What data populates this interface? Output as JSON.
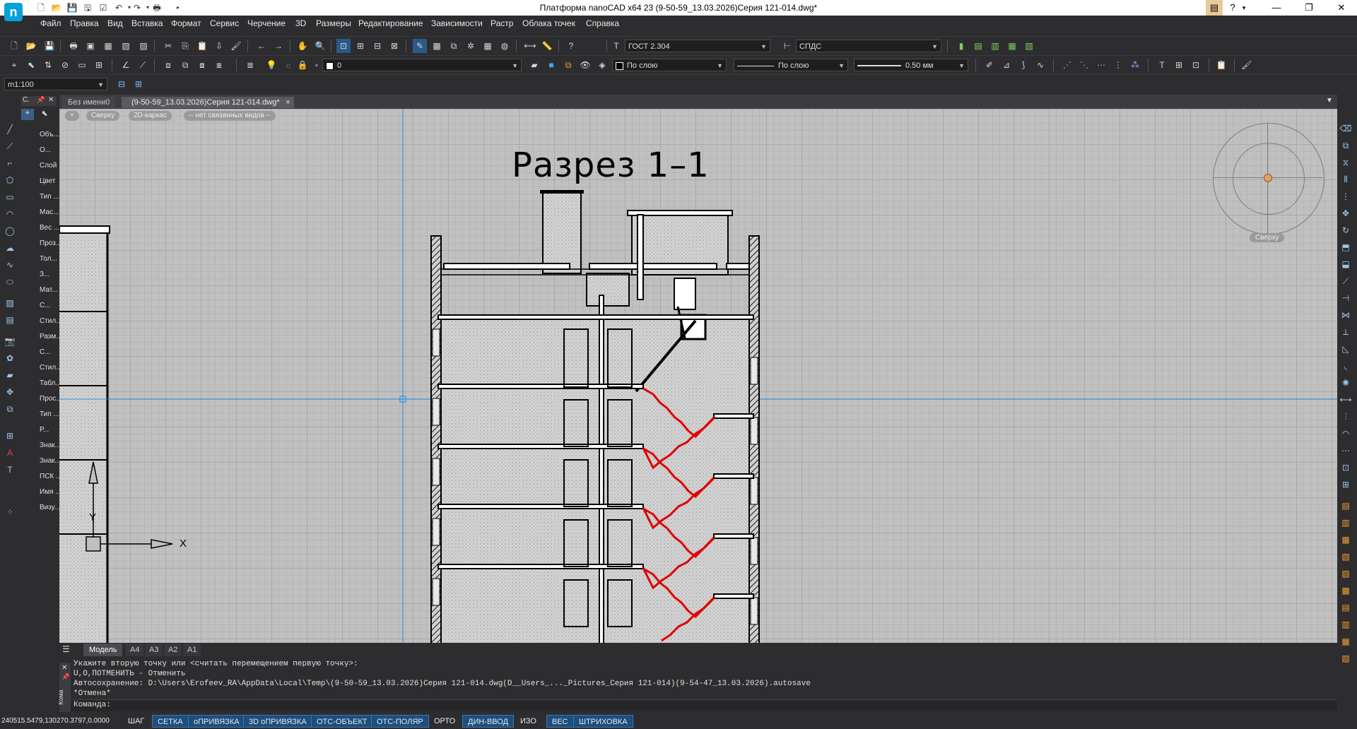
{
  "app": {
    "title": "Платформа nanoCAD x64 23 (9-50-59_13.03.2026)Серия 121-014.dwg*",
    "logo": "n"
  },
  "menu": [
    "Файл",
    "Правка",
    "Вид",
    "Вставка",
    "Формат",
    "Сервис",
    "Черчение",
    "3D",
    "Размеры",
    "Редактирование",
    "Зависимости",
    "Растр",
    "Облака точек",
    "Справка"
  ],
  "toolbar": {
    "text_style": "ГОСТ 2.304",
    "dim_style": "СПДС",
    "layer": "0",
    "color": "По слою",
    "linetype": "По слою",
    "lineweight": "0.50 мм",
    "scale": "m1:100"
  },
  "tabs": {
    "doc1": "Без имени0",
    "doc2": "(9-50-59_13.03.2026)Серия 121-014.dwg*",
    "close": "×"
  },
  "viewport_controls": [
    "+",
    "Сверху",
    "2D-каркас",
    "-- нет связанных видов --"
  ],
  "drawing": {
    "title": "Разрез 1–1",
    "ucs_y": "Y",
    "ucs_x": "X"
  },
  "viewcube": {
    "label": "Сверху"
  },
  "properties_panel": {
    "header": "С.",
    "items": [
      "Объ...",
      "О...",
      "Слой",
      "Цвет",
      "Тип ...",
      "Мас...",
      "Вес ...",
      "Проз...",
      "Тол...",
      "З...",
      "Мат...",
      "С...",
      "Стил...",
      "Разм...",
      "С...",
      "Стил...",
      "Табл...",
      "Прос...",
      "Тип ...",
      "Р...",
      "Знак...",
      "Знак...",
      "ПСК ...",
      "Имя ...",
      "Визу..."
    ]
  },
  "layout_tabs": [
    "Модель",
    "А4",
    "А3",
    "А2",
    "А1"
  ],
  "command": {
    "lines": [
      "Укажите вторую точку или <считать перемещением первую точку>:",
      "U,O,ПОТМЕНИТЬ - Отменить",
      "Автосохранение: D:\\Users\\Erofeev_RA\\AppData\\Local\\Temp\\(9-50-59_13.03.2026)Серия 121-014.dwg(D__Users_..._Pictures_Серия 121-014)(9-54-47_13.03.2026).autosave",
      "*Отмена*"
    ],
    "prompt": "Команда:",
    "side_label": "Кома"
  },
  "status": {
    "coords": "240515.5479,130270.3797,0.0000",
    "buttons": [
      {
        "label": "ШАГ",
        "on": false
      },
      {
        "label": "СЕТКА",
        "on": true
      },
      {
        "label": "оПРИВЯЗКА",
        "on": true
      },
      {
        "label": "3D оПРИВЯЗКА",
        "on": true
      },
      {
        "label": "ОТС-ОБЪЕКТ",
        "on": true
      },
      {
        "label": "ОТС-ПОЛЯР",
        "on": true
      },
      {
        "label": "ОРТО",
        "on": false
      },
      {
        "label": "ДИН-ВВОД",
        "on": true
      },
      {
        "label": "ИЗО",
        "on": false
      },
      {
        "label": "ВЕС",
        "on": true
      },
      {
        "label": "ШТРИХОВКА",
        "on": true
      }
    ]
  },
  "colors": {
    "accent": "#1d4e7e",
    "stairs": "#e00000",
    "crosshair": "#1f8be0",
    "canvas": "#c0c0c0"
  }
}
